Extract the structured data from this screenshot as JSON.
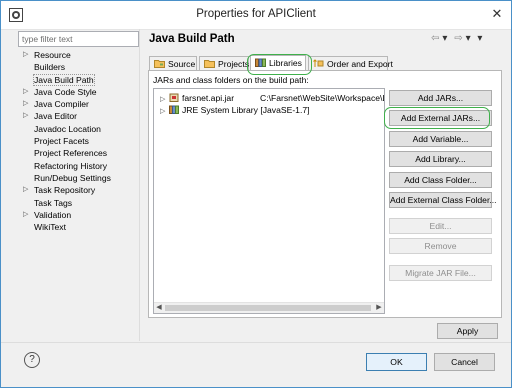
{
  "window": {
    "title": "Properties for APIClient",
    "close_glyph": "✕"
  },
  "filter": {
    "placeholder": "type filter text",
    "value": ""
  },
  "tree": [
    {
      "label": "Resource",
      "expandable": true
    },
    {
      "label": "Builders",
      "expandable": false
    },
    {
      "label": "Java Build Path",
      "expandable": false,
      "selected": true
    },
    {
      "label": "Java Code Style",
      "expandable": true
    },
    {
      "label": "Java Compiler",
      "expandable": true
    },
    {
      "label": "Java Editor",
      "expandable": true
    },
    {
      "label": "Javadoc Location",
      "expandable": false
    },
    {
      "label": "Project Facets",
      "expandable": false
    },
    {
      "label": "Project References",
      "expandable": false
    },
    {
      "label": "Refactoring History",
      "expandable": false
    },
    {
      "label": "Run/Debug Settings",
      "expandable": false
    },
    {
      "label": "Task Repository",
      "expandable": true
    },
    {
      "label": "Task Tags",
      "expandable": false
    },
    {
      "label": "Validation",
      "expandable": true
    },
    {
      "label": "WikiText",
      "expandable": false
    }
  ],
  "page": {
    "title": "Java Build Path"
  },
  "nav": {
    "back": "⇦",
    "forward": "⇨",
    "menu": "▾"
  },
  "tabs": [
    {
      "label": "Source",
      "icon": "source-folder-icon"
    },
    {
      "label": "Projects",
      "icon": "projects-icon"
    },
    {
      "label": "Libraries",
      "icon": "libraries-icon",
      "active": true
    },
    {
      "label": "Order and Export",
      "icon": "order-export-icon"
    }
  ],
  "libraries": {
    "caption": "JARs and class folders on the build path:",
    "items": [
      {
        "name": "farsnet.api.jar",
        "path": "C:\\Farsnet\\WebSite\\Workspace\\Li",
        "icon": "jar-icon"
      },
      {
        "name": "JRE System Library [JavaSE-1.7]",
        "icon": "library-icon"
      }
    ]
  },
  "buttons": [
    {
      "label": "Add JARs...",
      "enabled": true
    },
    {
      "label": "Add External JARs...",
      "enabled": true
    },
    {
      "label": "Add Variable...",
      "enabled": true
    },
    {
      "label": "Add Library...",
      "enabled": true
    },
    {
      "label": "Add Class Folder...",
      "enabled": true
    },
    {
      "label": "Add External Class Folder...",
      "enabled": true
    },
    {
      "label": "Edit...",
      "enabled": false
    },
    {
      "label": "Remove",
      "enabled": false
    },
    {
      "label": "Migrate JAR File...",
      "enabled": false
    }
  ],
  "apply": {
    "label": "Apply"
  },
  "footer": {
    "help": "?",
    "ok": "OK",
    "cancel": "Cancel"
  },
  "colors": {
    "highlight": "#3fb04b",
    "accent": "#4a90c8"
  }
}
